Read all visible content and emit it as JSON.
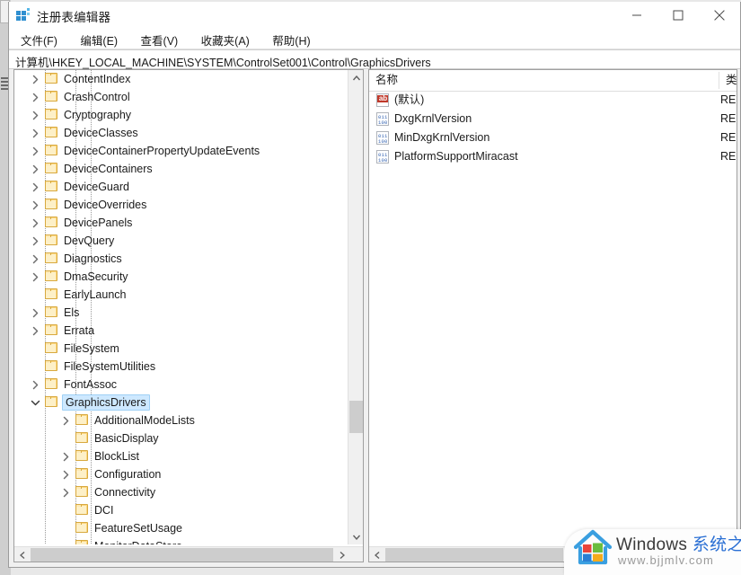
{
  "window": {
    "title": "注册表编辑器",
    "icon": "registry-grid-icon",
    "controls": {
      "minimize": "minimize-icon",
      "maximize": "maximize-icon",
      "close": "close-icon"
    }
  },
  "menubar": {
    "items": [
      {
        "label": "文件(F)"
      },
      {
        "label": "编辑(E)"
      },
      {
        "label": "查看(V)"
      },
      {
        "label": "收藏夹(A)"
      },
      {
        "label": "帮助(H)"
      }
    ]
  },
  "addressbar": {
    "path": "计算机\\HKEY_LOCAL_MACHINE\\SYSTEM\\ControlSet001\\Control\\GraphicsDrivers"
  },
  "tree": {
    "nodes": [
      {
        "label": "ContentIndex",
        "depth": 1,
        "expander": "collapsed",
        "selected": false
      },
      {
        "label": "CrashControl",
        "depth": 1,
        "expander": "collapsed",
        "selected": false
      },
      {
        "label": "Cryptography",
        "depth": 1,
        "expander": "collapsed",
        "selected": false
      },
      {
        "label": "DeviceClasses",
        "depth": 1,
        "expander": "collapsed",
        "selected": false
      },
      {
        "label": "DeviceContainerPropertyUpdateEvents",
        "depth": 1,
        "expander": "collapsed",
        "selected": false
      },
      {
        "label": "DeviceContainers",
        "depth": 1,
        "expander": "collapsed",
        "selected": false
      },
      {
        "label": "DeviceGuard",
        "depth": 1,
        "expander": "collapsed",
        "selected": false
      },
      {
        "label": "DeviceOverrides",
        "depth": 1,
        "expander": "collapsed",
        "selected": false
      },
      {
        "label": "DevicePanels",
        "depth": 1,
        "expander": "collapsed",
        "selected": false
      },
      {
        "label": "DevQuery",
        "depth": 1,
        "expander": "collapsed",
        "selected": false
      },
      {
        "label": "Diagnostics",
        "depth": 1,
        "expander": "collapsed",
        "selected": false
      },
      {
        "label": "DmaSecurity",
        "depth": 1,
        "expander": "collapsed",
        "selected": false
      },
      {
        "label": "EarlyLaunch",
        "depth": 1,
        "expander": "none",
        "selected": false
      },
      {
        "label": "Els",
        "depth": 1,
        "expander": "collapsed",
        "selected": false
      },
      {
        "label": "Errata",
        "depth": 1,
        "expander": "collapsed",
        "selected": false
      },
      {
        "label": "FileSystem",
        "depth": 1,
        "expander": "none",
        "selected": false
      },
      {
        "label": "FileSystemUtilities",
        "depth": 1,
        "expander": "none",
        "selected": false
      },
      {
        "label": "FontAssoc",
        "depth": 1,
        "expander": "collapsed",
        "selected": false
      },
      {
        "label": "GraphicsDrivers",
        "depth": 1,
        "expander": "expanded",
        "selected": true
      },
      {
        "label": "AdditionalModeLists",
        "depth": 2,
        "expander": "collapsed",
        "selected": false
      },
      {
        "label": "BasicDisplay",
        "depth": 2,
        "expander": "none",
        "selected": false
      },
      {
        "label": "BlockList",
        "depth": 2,
        "expander": "collapsed",
        "selected": false
      },
      {
        "label": "Configuration",
        "depth": 2,
        "expander": "collapsed",
        "selected": false
      },
      {
        "label": "Connectivity",
        "depth": 2,
        "expander": "collapsed",
        "selected": false
      },
      {
        "label": "DCI",
        "depth": 2,
        "expander": "none",
        "selected": false
      },
      {
        "label": "FeatureSetUsage",
        "depth": 2,
        "expander": "none",
        "selected": false
      },
      {
        "label": "MonitorDataStore",
        "depth": 2,
        "expander": "none",
        "selected": false
      }
    ]
  },
  "list": {
    "columns": [
      {
        "label": "名称"
      },
      {
        "label": "类"
      }
    ],
    "rows": [
      {
        "name": "(默认)",
        "type": "RE",
        "icon": "string-value-icon"
      },
      {
        "name": "DxgKrnlVersion",
        "type": "RE",
        "icon": "binary-value-icon"
      },
      {
        "name": "MinDxgKrnlVersion",
        "type": "RE",
        "icon": "binary-value-icon"
      },
      {
        "name": "PlatformSupportMiracast",
        "type": "RE",
        "icon": "binary-value-icon"
      }
    ]
  },
  "watermark": {
    "brand_en": "Windows ",
    "brand_cn": "系统之家",
    "url": "www.bjjmlv.com"
  },
  "colors": {
    "selection": "#cde8ff",
    "folder": "#fcd77f",
    "accent_blue": "#2a6fd4",
    "string_icon": "#c0392b",
    "binary_icon": "#2f5fb0"
  }
}
